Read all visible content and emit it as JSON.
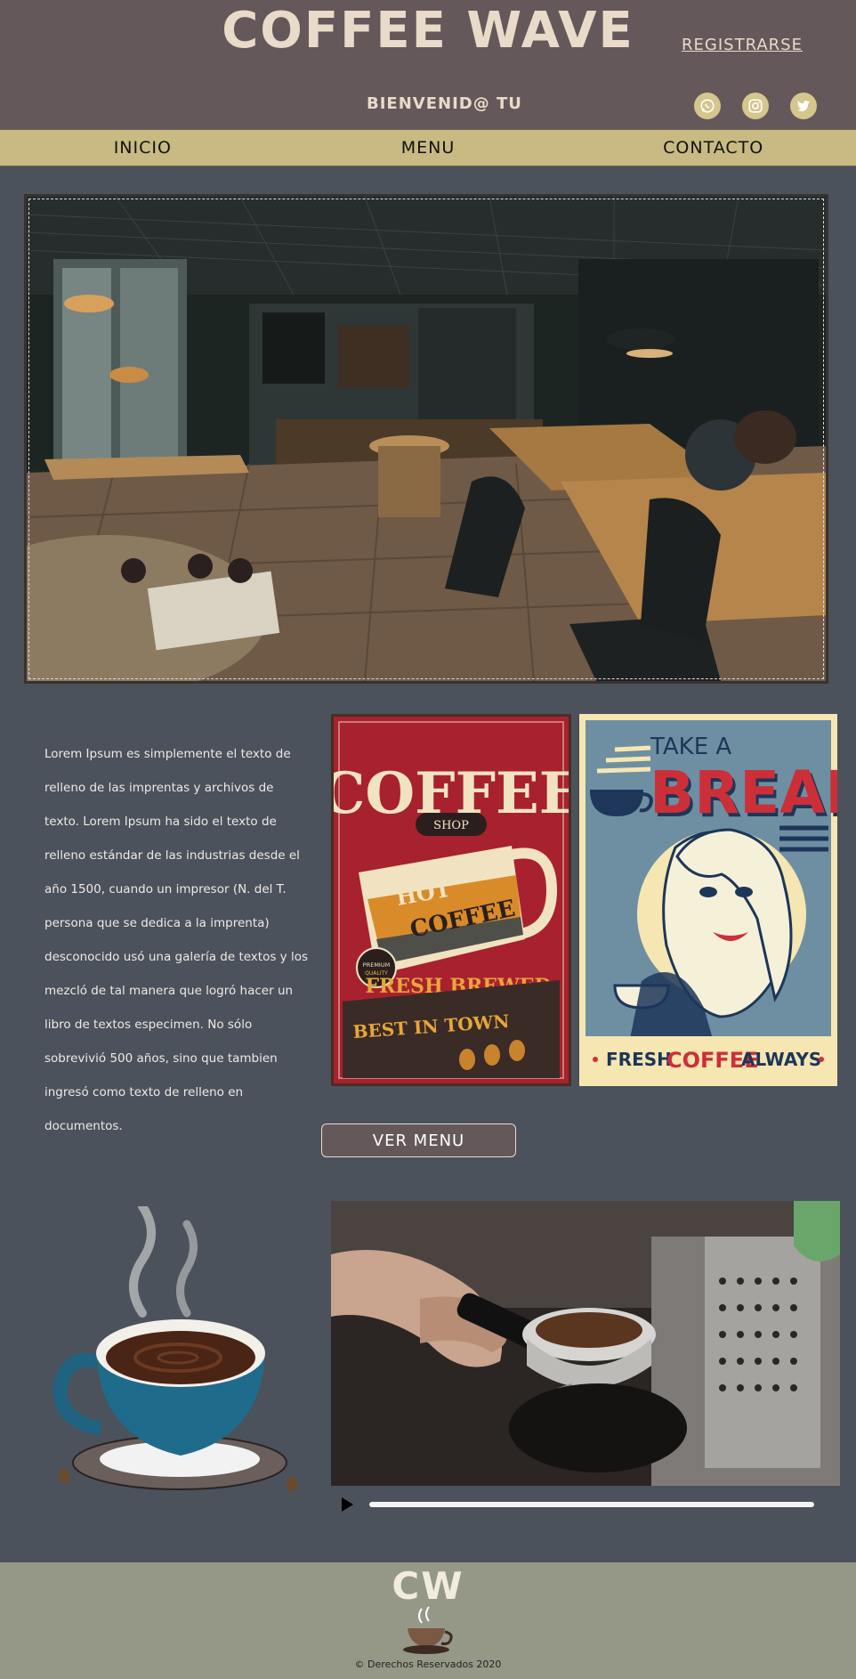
{
  "header": {
    "brand_title": "COFFEE WAVE",
    "register_link": "REGISTRARSE",
    "welcome_text": "BIENVENID@ TU",
    "social_icons": [
      "whatsapp-icon",
      "instagram-icon",
      "twitter-icon"
    ],
    "colors": {
      "header_bg": "#65585a",
      "title": "#e9dbc9",
      "social_bg": "#d4c68d"
    }
  },
  "nav": {
    "items": [
      "INICIO",
      "MENU",
      "CONTACTO"
    ],
    "bg": "#c8ba82"
  },
  "hero": {
    "image": "cafe interior photo"
  },
  "intro": {
    "paragraph": "Lorem Ipsum es simplemente el texto de relleno de las imprentas y archivos de texto. Lorem Ipsum ha sido el texto de relleno estándar de las industrias desde el año 1500, cuando un impresor (N. del T. persona que se dedica a la imprenta) desconocido usó una galería de textos y los mezcló de tal manera que logró hacer un libro de textos especimen. No sólo sobrevivió 500 años, sino que tambien ingresó como texto de relleno en documentos."
  },
  "poster_coffee": {
    "title": "COFFEE",
    "badge": "SHOP",
    "cup_text_1": "HOT",
    "cup_text_2": "COFFEE",
    "seal_1": "PREMIUM",
    "seal_2": "QUALITY",
    "line_1": "FRESH BREWED",
    "line_2": "BEST IN TOWN"
  },
  "poster_break": {
    "line_1": "TAKE A",
    "line_2": "BREAK",
    "footer_1": "FRESH",
    "footer_2": "COFFEE",
    "footer_3": "ALWAYS"
  },
  "actions": {
    "menu_button": "VER MENU"
  },
  "video": {
    "progress": 0
  },
  "footer": {
    "logo": "CW",
    "copyright": "© Derechos Reservados 2020"
  },
  "page_bg": "#4b525b"
}
